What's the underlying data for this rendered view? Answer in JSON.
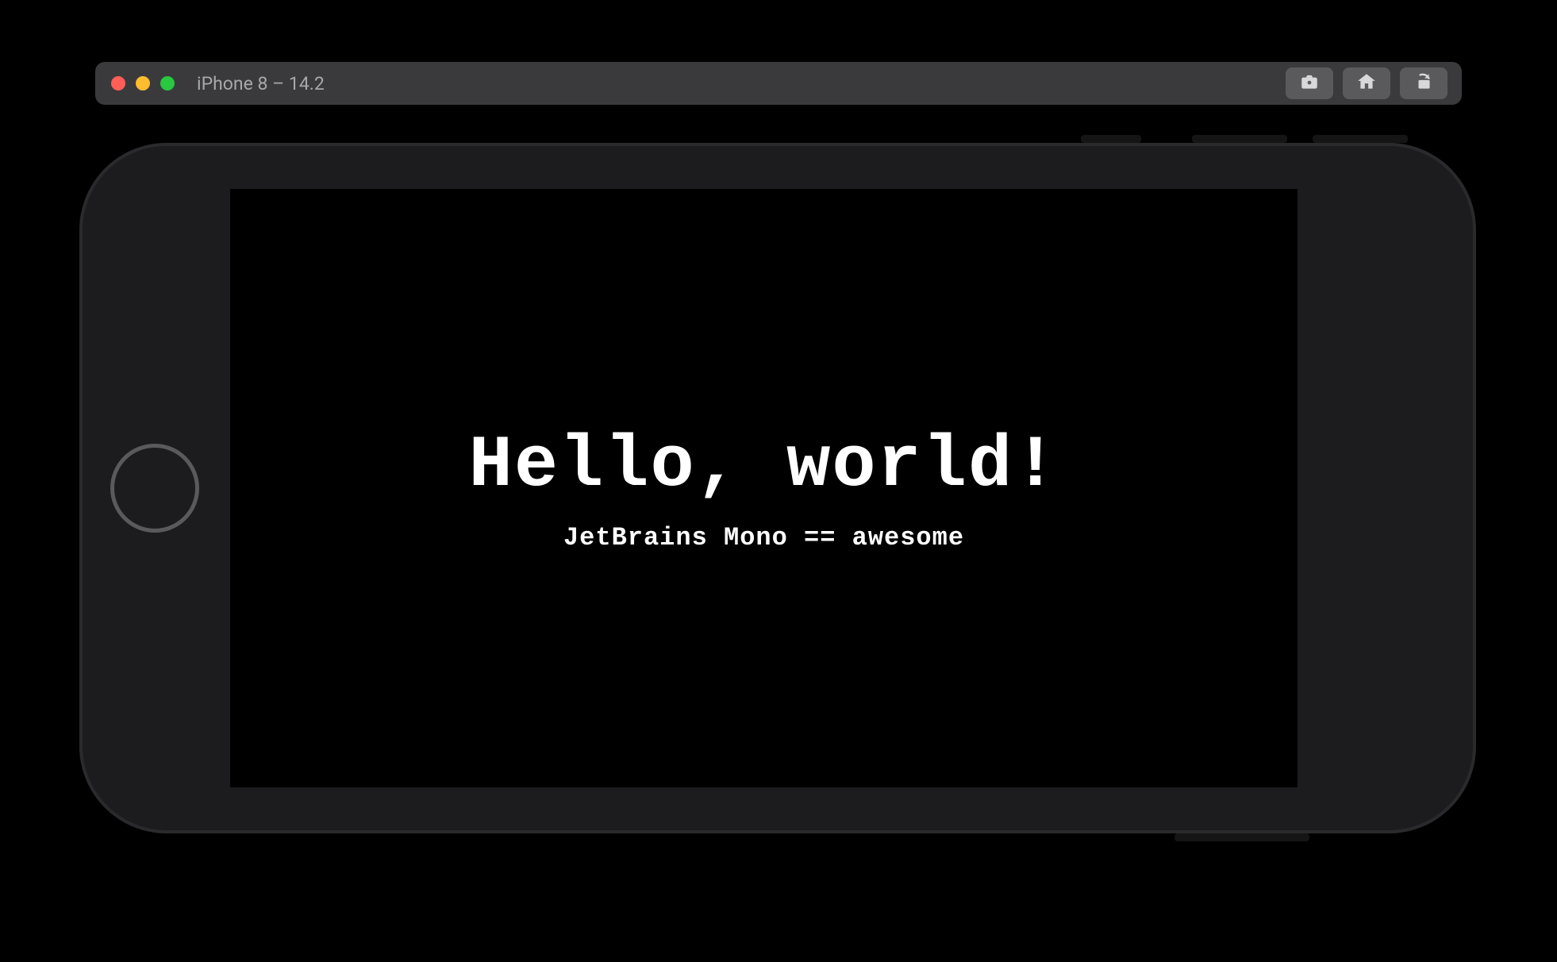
{
  "titlebar": {
    "title": "iPhone 8 – 14.2"
  },
  "screen": {
    "main_text": "Hello, world!",
    "sub_text": "JetBrains Mono == awesome"
  }
}
